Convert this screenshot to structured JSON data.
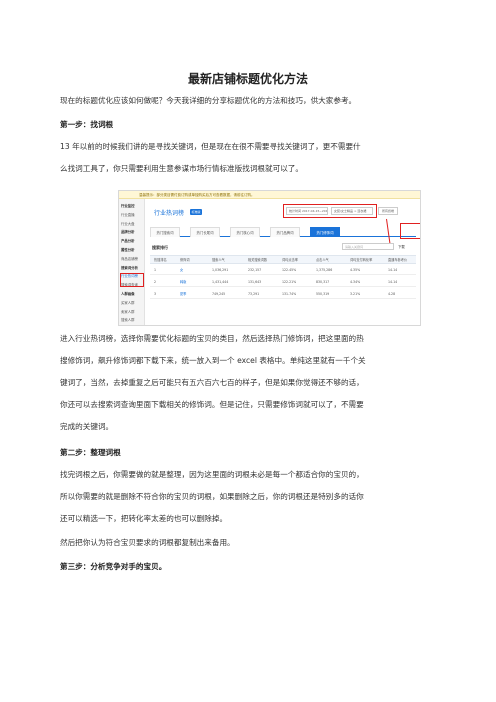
{
  "title": "最新店铺标题优化方法",
  "intro": "现在的标题优化应该如何做呢？今天我详细的分享标题优化的方法和技巧，供大家参考。",
  "step1": {
    "heading": "第一步：找词根",
    "lines": [
      "13 年以前的时候我们讲的是寻找关键词，但是现在在很不需要寻找关键词了，更不需要什",
      "么找词工具了，你只需要利用生意参谋市场行情标准版找词根就可以了。"
    ]
  },
  "screenshot": {
    "notice": "温馨提示：部分类目需付费订购或单独购买后方可查看数据，请前往订购。",
    "sidebar": [
      {
        "label": "行业监控",
        "group": true
      },
      {
        "label": "行业直播",
        "group": false
      },
      {
        "label": "行业大盘",
        "group": false
      },
      {
        "label": "品牌分析",
        "group": true
      },
      {
        "label": "产品分析",
        "group": true
      },
      {
        "label": "属性分析",
        "group": true
      },
      {
        "label": "商品店铺榜",
        "group": false
      },
      {
        "label": "搜索词分析",
        "group": true
      },
      {
        "label": "行业热词榜",
        "group": false,
        "active": true
      },
      {
        "label": "搜索词查询",
        "group": false
      },
      {
        "label": "人群画像",
        "group": true
      },
      {
        "label": "买家人群",
        "group": false
      },
      {
        "label": "卖家人群",
        "group": false
      },
      {
        "label": "搜索人群",
        "group": false
      }
    ],
    "bar_title": "行业热词榜",
    "bar_tag": "标准版",
    "date_range": "统计时间 2017-04-15~2017-04-21",
    "category": "女装/女士精品 > 连衣裙",
    "download_btn": "所有终端",
    "tabs": [
      "热门搜索词",
      "热门长尾词",
      "热门核心词",
      "热门品牌词",
      "热门修饰词"
    ],
    "active_tab": 4,
    "section_title": "搜索排行",
    "search_placeholder": "请输入关键词",
    "download_link": "下载",
    "columns": [
      "热搜排名",
      "修饰词",
      "搜索人气",
      "相关搜索词数",
      "词均点击率",
      "点击人气",
      "词均支付转化率",
      "直通车参考价"
    ],
    "rows": [
      [
        "1",
        "女",
        "1,036,291",
        "232,157",
        "122.45%",
        "1,375,286",
        "4.35%",
        "14.14"
      ],
      [
        "2",
        "韩版",
        "1,431,444",
        "131,643",
        "122.21%",
        "830,317",
        "4.34%",
        "14.14"
      ],
      [
        "3",
        "夏季",
        "749,245",
        "73,291",
        "131.74%",
        "550,319",
        "3.21%",
        "4.28"
      ]
    ]
  },
  "after_shot": [
    "进入行业热词榜，选择你需要优化标题的宝贝的类目，然后选择热门修饰词，把这里面的热",
    "搜修饰词，飙升修饰词都下载下来，统一放入到一个 excel 表格中。单纯这里就有一千个关",
    "键词了，当然，去掉重复之后可能只有五六百六七百的样子，但是如果你觉得还不够的话，",
    "你还可以去搜索词查询里面下载相关的修饰词。但是记住，只需要修饰词就可以了，不需要",
    "完成的关键词。"
  ],
  "step2": {
    "heading": "第二步：整理词根",
    "lines": [
      "找完词根之后，你需要做的就是整理，因为这里面的词根未必是每一个都适合你的宝贝的，",
      "所以你需要的就是删除不符合你的宝贝的词根，如果删除之后，你的词根还是特别多的话你",
      "还可以精选一下，把转化率太差的也可以删除掉。",
      "然后把你认为符合宝贝要求的词根都复制出来备用。"
    ]
  },
  "step3": {
    "heading": "第三步：分析竞争对手的宝贝。"
  }
}
